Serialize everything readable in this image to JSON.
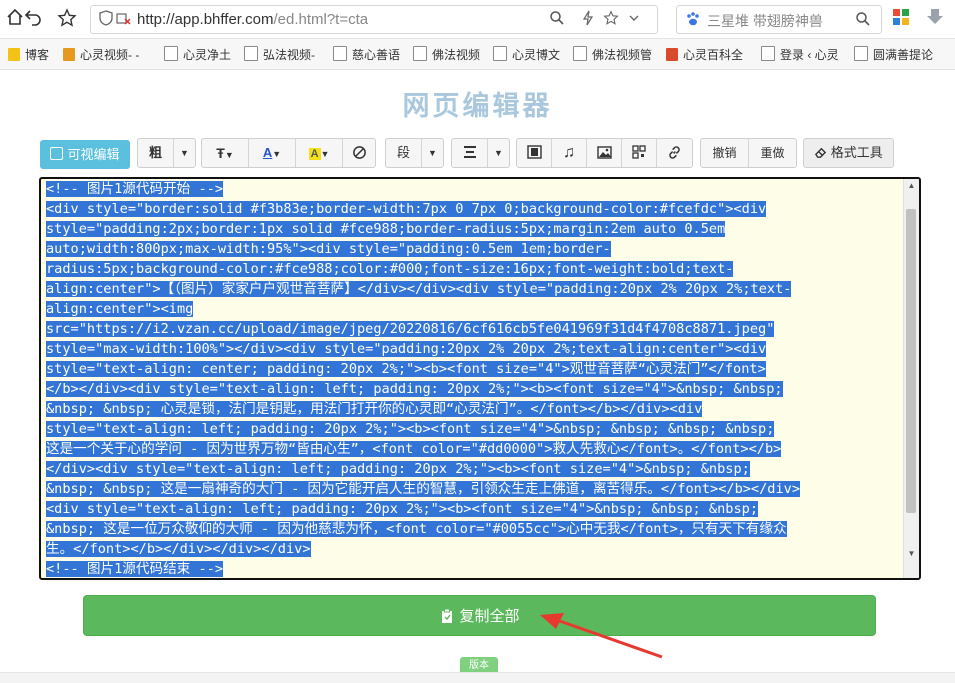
{
  "browser": {
    "url_host": "http://app.bhffer.com",
    "url_path": "/ed.html?t=cta",
    "search_placeholder": "三星堆 带翅膀神兽"
  },
  "bookmarks": [
    "博客",
    "心灵视频- -",
    "心灵净土",
    "弘法视频-",
    "慈心善语",
    "佛法视频",
    "心灵博文",
    "佛法视频管",
    "心灵百科全",
    "登录 ‹ 心灵",
    "圆满善提论"
  ],
  "page": {
    "title": "网页编辑器"
  },
  "toolbar": {
    "visual_edit": "可视编辑",
    "bold": "粗",
    "paragraph": "段",
    "undo": "撤销",
    "redo": "重做",
    "format_tool": "格式工具"
  },
  "editor": {
    "lines": [
      "<!-- 图片1源代码开始 -->",
      "<div style=\"border:solid #f3b83e;border-width:7px 0 7px 0;background-color:#fcefdc\"><div",
      "style=\"padding:2px;border:1px solid #fce988;border-radius:5px;margin:2em auto 0.5em",
      "auto;width:800px;max-width:95%\"><div style=\"padding:0.5em 1em;border-",
      "radius:5px;background-color:#fce988;color:#000;font-size:16px;font-weight:bold;text-",
      "align:center\">【（图片）家家户户观世音菩萨】</div></div><div style=\"padding:20px 2% 20px 2%;text-",
      "align:center\"><img",
      "src=\"https://i2.vzan.cc/upload/image/jpeg/20220816/6cf616cb5fe041969f31d4f4708c8871.jpeg\"",
      "style=\"max-width:100%\"></div><div style=\"padding:20px 2% 20px 2%;text-align:center\"><div",
      "style=\"text-align: center; padding: 20px 2%;\"><b><font size=\"4\">观世音菩萨“心灵法门”</font>",
      "</b></div><div style=\"text-align: left; padding: 20px 2%;\"><b><font size=\"4\">&nbsp; &nbsp;",
      "&nbsp; &nbsp; 心灵是锁，法门是钥匙，用法门打开你的心灵即“心灵法门”。</font></b></div><div",
      "style=\"text-align: left; padding: 20px 2%;\"><b><font size=\"4\">&nbsp; &nbsp; &nbsp; &nbsp;",
      "这是一个关于心的学问 - 因为世界万物“皆由心生”，<font color=\"#dd0000\">救人先救心</font>。</font></b>",
      "</div><div style=\"text-align: left; padding: 20px 2%;\"><b><font size=\"4\">&nbsp; &nbsp;",
      "&nbsp; &nbsp; 这是一扇神奇的大门 - 因为它能开启人生的智慧，引领众生走上佛道，离苦得乐。</font></b></div>",
      "<div style=\"text-align: left; padding: 20px 2%;\"><b><font size=\"4\">&nbsp; &nbsp; &nbsp;",
      "&nbsp; 这是一位万众敬仰的大师 - 因为他慈悲为怀，<font color=\"#0055cc\">心中无我</font>，只有天下有缘众",
      "生。</font></b></div></div></div>",
      "<!-- 图片1源代码结束 -->"
    ]
  },
  "actions": {
    "copy_all": "复制全部",
    "version": "版本"
  },
  "colors": {
    "visual_btn": "#5bc0de",
    "copy_btn": "#5cb85c",
    "selection": "#3375d6",
    "arrow": "#e8392f"
  }
}
